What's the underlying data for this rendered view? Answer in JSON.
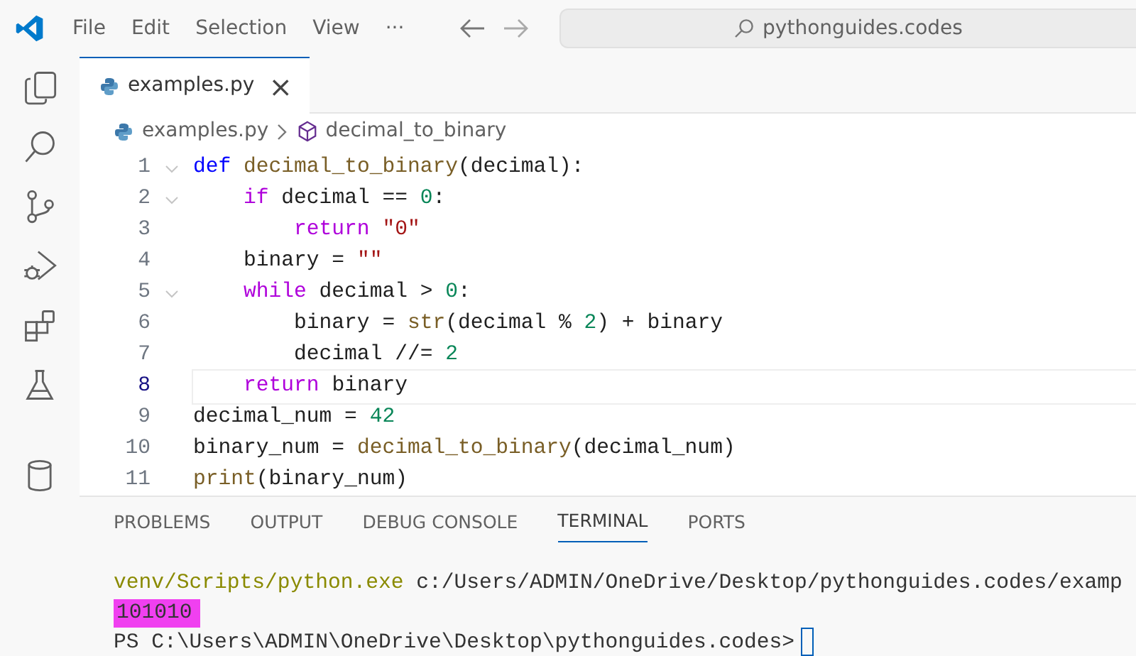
{
  "menu": [
    "File",
    "Edit",
    "Selection",
    "View",
    "···"
  ],
  "search": {
    "value": "pythonguides.codes"
  },
  "activity_bar": [
    {
      "kind": "files",
      "selected": false
    },
    {
      "kind": "search",
      "selected": false
    },
    {
      "kind": "source-control",
      "selected": false
    },
    {
      "kind": "debug",
      "selected": false
    },
    {
      "kind": "extensions",
      "selected": false
    },
    {
      "kind": "testing",
      "selected": false
    },
    {
      "kind": "database",
      "selected": false
    }
  ],
  "editor_tabs": [
    {
      "label": "examples.py",
      "close": "×",
      "selected": true
    }
  ],
  "breadcrumbs": [
    {
      "label": "examples.py",
      "kind": "file"
    },
    {
      "label": "decimal_to_binary",
      "kind": "function"
    }
  ],
  "code": [
    {
      "number": "1",
      "fold": true,
      "current": false,
      "tokens": [
        {
          "kind": "kw",
          "text": "def "
        },
        {
          "kind": "fn",
          "text": "decimal_to_binary"
        },
        {
          "kind": "plain",
          "text": "(decimal):"
        }
      ]
    },
    {
      "number": "2",
      "fold": true,
      "current": false,
      "tokens": [
        {
          "kind": "ctl",
          "text": "    if "
        },
        {
          "kind": "plain",
          "text": "decimal == "
        },
        {
          "kind": "num",
          "text": "0"
        },
        {
          "kind": "plain",
          "text": ":"
        }
      ]
    },
    {
      "number": "3",
      "fold": false,
      "current": false,
      "tokens": [
        {
          "kind": "ctl",
          "text": "        return "
        },
        {
          "kind": "str",
          "text": "\"0\""
        }
      ]
    },
    {
      "number": "4",
      "fold": false,
      "current": false,
      "tokens": [
        {
          "kind": "plain",
          "text": "    binary = "
        },
        {
          "kind": "str",
          "text": "\"\""
        }
      ]
    },
    {
      "number": "5",
      "fold": true,
      "current": false,
      "tokens": [
        {
          "kind": "ctl",
          "text": "    while "
        },
        {
          "kind": "plain",
          "text": "decimal > "
        },
        {
          "kind": "num",
          "text": "0"
        },
        {
          "kind": "plain",
          "text": ":"
        }
      ]
    },
    {
      "number": "6",
      "fold": false,
      "current": false,
      "tokens": [
        {
          "kind": "plain",
          "text": "        binary = "
        },
        {
          "kind": "fn",
          "text": "str"
        },
        {
          "kind": "plain",
          "text": "(decimal % "
        },
        {
          "kind": "num",
          "text": "2"
        },
        {
          "kind": "plain",
          "text": ") + binary"
        }
      ]
    },
    {
      "number": "7",
      "fold": false,
      "current": false,
      "tokens": [
        {
          "kind": "plain",
          "text": "        decimal //= "
        },
        {
          "kind": "num",
          "text": "2"
        }
      ]
    },
    {
      "number": "8",
      "fold": false,
      "current": true,
      "tokens": [
        {
          "kind": "ctl",
          "text": "    return "
        },
        {
          "kind": "plain",
          "text": "binary"
        }
      ]
    },
    {
      "number": "9",
      "fold": false,
      "current": false,
      "tokens": [
        {
          "kind": "plain",
          "text": "decimal_num = "
        },
        {
          "kind": "num",
          "text": "42"
        }
      ]
    },
    {
      "number": "10",
      "fold": false,
      "current": false,
      "tokens": [
        {
          "kind": "plain",
          "text": "binary_num = "
        },
        {
          "kind": "fn",
          "text": "decimal_to_binary"
        },
        {
          "kind": "plain",
          "text": "(decimal_num)"
        }
      ]
    },
    {
      "number": "11",
      "fold": false,
      "current": false,
      "tokens": [
        {
          "kind": "fn",
          "text": "print"
        },
        {
          "kind": "plain",
          "text": "(binary_num)"
        }
      ]
    }
  ],
  "panel_tabs": [
    {
      "label": "PROBLEMS",
      "selected": false
    },
    {
      "label": "OUTPUT",
      "selected": false
    },
    {
      "label": "DEBUG CONSOLE",
      "selected": false
    },
    {
      "label": "TERMINAL",
      "selected": true
    },
    {
      "label": "PORTS",
      "selected": false
    }
  ],
  "terminal": [
    {
      "kind": "command",
      "parts": [
        {
          "kind": "exe",
          "text": "venv/Scripts/python.exe"
        },
        {
          "kind": "plain",
          "text": " c:/Users/ADMIN/OneDrive/Desktop/pythonguides.codes/examp"
        }
      ]
    },
    {
      "kind": "output",
      "text": "101010",
      "highlighted": true
    },
    {
      "kind": "prompt",
      "text": "PS C:\\Users\\ADMIN\\OneDrive\\Desktop\\pythonguides.codes>",
      "cursor": true
    }
  ]
}
